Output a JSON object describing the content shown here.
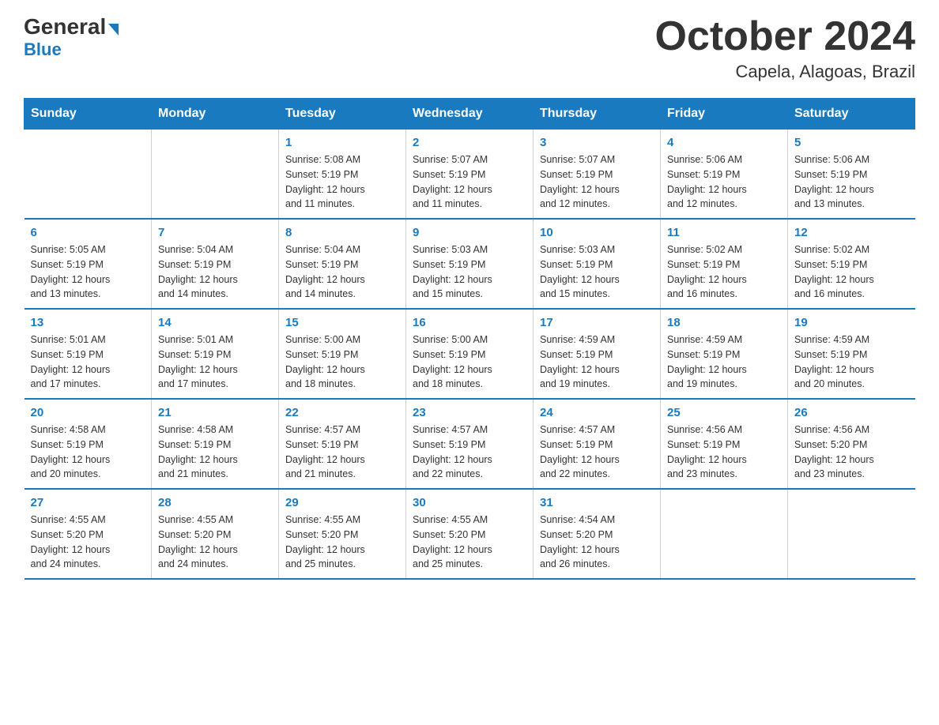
{
  "logo": {
    "general": "General",
    "blue": "Blue",
    "arrow": "▶"
  },
  "title": "October 2024",
  "subtitle": "Capela, Alagoas, Brazil",
  "headers": [
    "Sunday",
    "Monday",
    "Tuesday",
    "Wednesday",
    "Thursday",
    "Friday",
    "Saturday"
  ],
  "weeks": [
    [
      {
        "day": "",
        "info": ""
      },
      {
        "day": "",
        "info": ""
      },
      {
        "day": "1",
        "info": "Sunrise: 5:08 AM\nSunset: 5:19 PM\nDaylight: 12 hours\nand 11 minutes."
      },
      {
        "day": "2",
        "info": "Sunrise: 5:07 AM\nSunset: 5:19 PM\nDaylight: 12 hours\nand 11 minutes."
      },
      {
        "day": "3",
        "info": "Sunrise: 5:07 AM\nSunset: 5:19 PM\nDaylight: 12 hours\nand 12 minutes."
      },
      {
        "day": "4",
        "info": "Sunrise: 5:06 AM\nSunset: 5:19 PM\nDaylight: 12 hours\nand 12 minutes."
      },
      {
        "day": "5",
        "info": "Sunrise: 5:06 AM\nSunset: 5:19 PM\nDaylight: 12 hours\nand 13 minutes."
      }
    ],
    [
      {
        "day": "6",
        "info": "Sunrise: 5:05 AM\nSunset: 5:19 PM\nDaylight: 12 hours\nand 13 minutes."
      },
      {
        "day": "7",
        "info": "Sunrise: 5:04 AM\nSunset: 5:19 PM\nDaylight: 12 hours\nand 14 minutes."
      },
      {
        "day": "8",
        "info": "Sunrise: 5:04 AM\nSunset: 5:19 PM\nDaylight: 12 hours\nand 14 minutes."
      },
      {
        "day": "9",
        "info": "Sunrise: 5:03 AM\nSunset: 5:19 PM\nDaylight: 12 hours\nand 15 minutes."
      },
      {
        "day": "10",
        "info": "Sunrise: 5:03 AM\nSunset: 5:19 PM\nDaylight: 12 hours\nand 15 minutes."
      },
      {
        "day": "11",
        "info": "Sunrise: 5:02 AM\nSunset: 5:19 PM\nDaylight: 12 hours\nand 16 minutes."
      },
      {
        "day": "12",
        "info": "Sunrise: 5:02 AM\nSunset: 5:19 PM\nDaylight: 12 hours\nand 16 minutes."
      }
    ],
    [
      {
        "day": "13",
        "info": "Sunrise: 5:01 AM\nSunset: 5:19 PM\nDaylight: 12 hours\nand 17 minutes."
      },
      {
        "day": "14",
        "info": "Sunrise: 5:01 AM\nSunset: 5:19 PM\nDaylight: 12 hours\nand 17 minutes."
      },
      {
        "day": "15",
        "info": "Sunrise: 5:00 AM\nSunset: 5:19 PM\nDaylight: 12 hours\nand 18 minutes."
      },
      {
        "day": "16",
        "info": "Sunrise: 5:00 AM\nSunset: 5:19 PM\nDaylight: 12 hours\nand 18 minutes."
      },
      {
        "day": "17",
        "info": "Sunrise: 4:59 AM\nSunset: 5:19 PM\nDaylight: 12 hours\nand 19 minutes."
      },
      {
        "day": "18",
        "info": "Sunrise: 4:59 AM\nSunset: 5:19 PM\nDaylight: 12 hours\nand 19 minutes."
      },
      {
        "day": "19",
        "info": "Sunrise: 4:59 AM\nSunset: 5:19 PM\nDaylight: 12 hours\nand 20 minutes."
      }
    ],
    [
      {
        "day": "20",
        "info": "Sunrise: 4:58 AM\nSunset: 5:19 PM\nDaylight: 12 hours\nand 20 minutes."
      },
      {
        "day": "21",
        "info": "Sunrise: 4:58 AM\nSunset: 5:19 PM\nDaylight: 12 hours\nand 21 minutes."
      },
      {
        "day": "22",
        "info": "Sunrise: 4:57 AM\nSunset: 5:19 PM\nDaylight: 12 hours\nand 21 minutes."
      },
      {
        "day": "23",
        "info": "Sunrise: 4:57 AM\nSunset: 5:19 PM\nDaylight: 12 hours\nand 22 minutes."
      },
      {
        "day": "24",
        "info": "Sunrise: 4:57 AM\nSunset: 5:19 PM\nDaylight: 12 hours\nand 22 minutes."
      },
      {
        "day": "25",
        "info": "Sunrise: 4:56 AM\nSunset: 5:19 PM\nDaylight: 12 hours\nand 23 minutes."
      },
      {
        "day": "26",
        "info": "Sunrise: 4:56 AM\nSunset: 5:20 PM\nDaylight: 12 hours\nand 23 minutes."
      }
    ],
    [
      {
        "day": "27",
        "info": "Sunrise: 4:55 AM\nSunset: 5:20 PM\nDaylight: 12 hours\nand 24 minutes."
      },
      {
        "day": "28",
        "info": "Sunrise: 4:55 AM\nSunset: 5:20 PM\nDaylight: 12 hours\nand 24 minutes."
      },
      {
        "day": "29",
        "info": "Sunrise: 4:55 AM\nSunset: 5:20 PM\nDaylight: 12 hours\nand 25 minutes."
      },
      {
        "day": "30",
        "info": "Sunrise: 4:55 AM\nSunset: 5:20 PM\nDaylight: 12 hours\nand 25 minutes."
      },
      {
        "day": "31",
        "info": "Sunrise: 4:54 AM\nSunset: 5:20 PM\nDaylight: 12 hours\nand 26 minutes."
      },
      {
        "day": "",
        "info": ""
      },
      {
        "day": "",
        "info": ""
      }
    ]
  ]
}
